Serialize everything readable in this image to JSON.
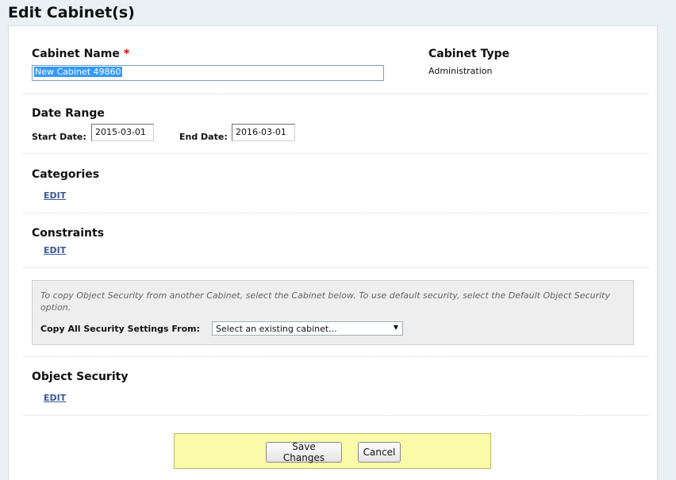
{
  "page": {
    "title": "Edit Cabinet(s)"
  },
  "cabinet_name": {
    "label": "Cabinet Name",
    "required_marker": "*",
    "value": "New Cabinet 49860"
  },
  "cabinet_type": {
    "label": "Cabinet Type",
    "value": "Administration"
  },
  "date_range": {
    "title": "Date Range",
    "start_label": "Start Date:",
    "start_value": "2015-03-01",
    "end_label": "End Date:",
    "end_value": "2016-03-01"
  },
  "categories": {
    "title": "Categories",
    "edit_label": "EDIT"
  },
  "constraints": {
    "title": "Constraints",
    "edit_label": "EDIT"
  },
  "copy_security": {
    "help_text": "To copy Object Security from another Cabinet, select the Cabinet below. To use default security, select the Default Object Security option.",
    "label": "Copy All Security Settings From:",
    "selected": "Select an existing cabinet..."
  },
  "object_security": {
    "title": "Object Security",
    "edit_label": "EDIT"
  },
  "footer": {
    "save_label": "Save Changes",
    "cancel_label": "Cancel"
  },
  "colors": {
    "footer_bg": "#fafaa8",
    "link": "#3a5a9a",
    "required": "#d40000",
    "selection": "#3399ff"
  },
  "icons": {
    "select_arrow": "chevron-down-icon"
  }
}
